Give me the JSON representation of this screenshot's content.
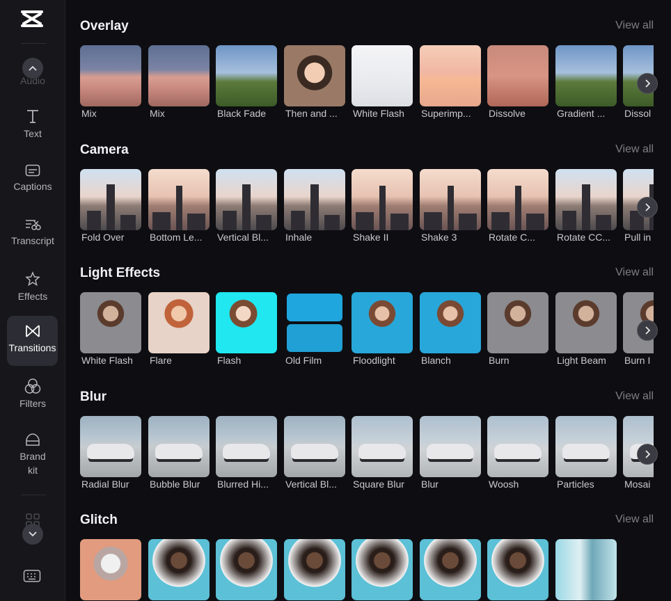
{
  "sidebar": {
    "ghost_label": "Audio",
    "items": [
      {
        "label": "Text",
        "icon": "text-icon"
      },
      {
        "label": "Captions",
        "icon": "captions-icon"
      },
      {
        "label": "Transcript",
        "icon": "transcript-icon"
      },
      {
        "label": "Effects",
        "icon": "effects-icon"
      },
      {
        "label": "Transitions",
        "icon": "transitions-icon"
      },
      {
        "label": "Filters",
        "icon": "filters-icon"
      },
      {
        "label": "Brand kit",
        "icon": "brand-kit-icon"
      }
    ]
  },
  "view_all_label": "View all",
  "sections": [
    {
      "title": "Overlay",
      "items": [
        "Mix",
        "Mix",
        "Black Fade",
        "Then and ...",
        "White Flash",
        "Superimp...",
        "Dissolve",
        "Gradient ...",
        "Dissol"
      ]
    },
    {
      "title": "Camera",
      "items": [
        "Fold Over",
        "Bottom Le...",
        "Vertical Bl...",
        "Inhale",
        "Shake II",
        "Shake 3",
        "Rotate C...",
        "Rotate CC...",
        "Pull in"
      ]
    },
    {
      "title": "Light Effects",
      "items": [
        "White Flash",
        "Flare",
        "Flash",
        "Old Film",
        "Floodlight",
        "Blanch",
        "Burn",
        "Light Beam",
        "Burn I"
      ]
    },
    {
      "title": "Blur",
      "items": [
        "Radial Blur",
        "Bubble Blur",
        "Blurred Hi...",
        "Vertical Bl...",
        "Square Blur",
        "Blur",
        "Woosh",
        "Particles",
        "Mosai"
      ]
    },
    {
      "title": "Glitch",
      "items": [
        "",
        "",
        "",
        "",
        "",
        "",
        "",
        ""
      ]
    }
  ],
  "colors": {
    "background": "#0e0e12",
    "sidebar": "#16161b",
    "active_item": "#2c2c34",
    "muted_text": "#7d7d85"
  }
}
